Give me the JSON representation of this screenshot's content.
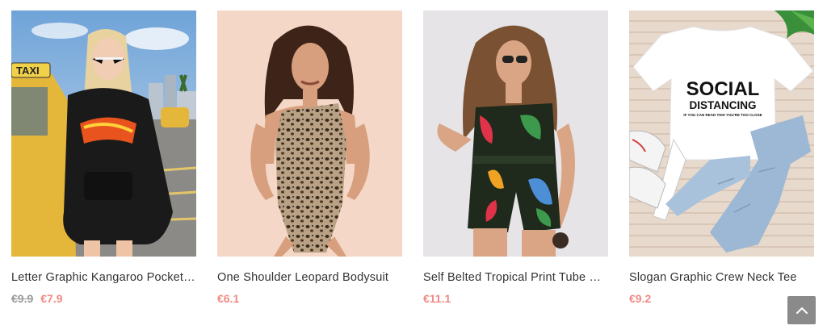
{
  "products": [
    {
      "title": "Letter Graphic Kangaroo Pocket ...",
      "old_price": "€9.9",
      "price": "€7.9"
    },
    {
      "title": "One Shoulder Leopard Bodysuit",
      "price": "€6.1"
    },
    {
      "title": "Self Belted Tropical Print Tube Ro...",
      "price": "€11.1"
    },
    {
      "title": "Slogan Graphic Crew Neck Tee",
      "price": "€9.2"
    }
  ],
  "images": {
    "taxi_sign": "TAXI",
    "shirt_line1": "SOCIAL",
    "shirt_line2": "DISTANCING",
    "shirt_line3": "IF YOU CAN READ THIS YOU'RE TOO CLOSE"
  },
  "colors": {
    "sale_price": "#f08a84",
    "old_price": "#9a9a9a",
    "title_text": "#333333",
    "back_to_top_bg": "#8a8a8a"
  },
  "icons": {
    "back_to_top": "chevron-up-icon"
  }
}
